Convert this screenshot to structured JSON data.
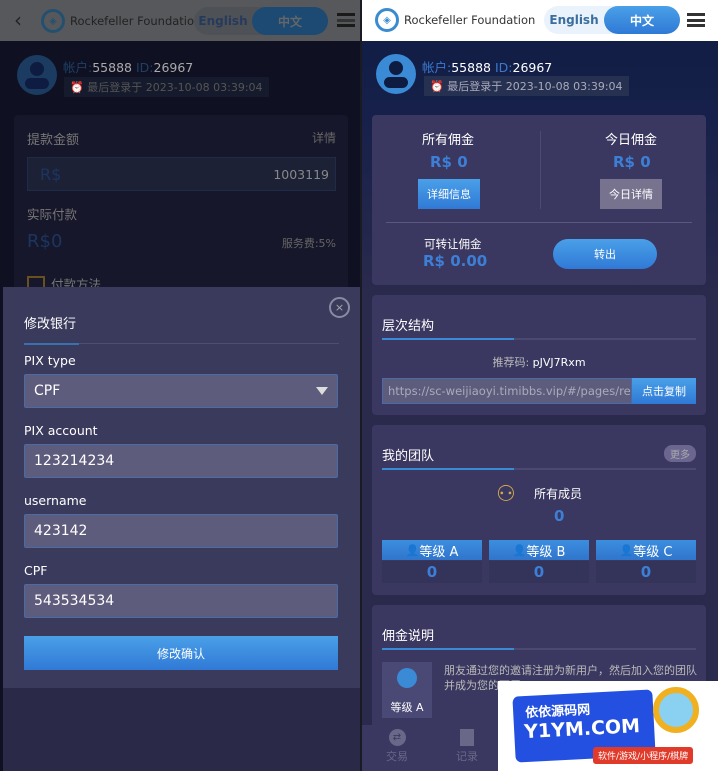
{
  "header": {
    "brand": "Rockefeller Foundation",
    "lang_en": "English",
    "lang_zh": "中文"
  },
  "user": {
    "account_label": "帐户:",
    "account": "55888",
    "id_label": "ID:",
    "id": "26967",
    "last_login": "最后登录于 2023-10-08 03:39:04"
  },
  "withdraw": {
    "title": "提款金额",
    "detail": "详情",
    "currency": "R$",
    "balance": "1003119",
    "actual_label": "实际付款",
    "actual_value": "R$0",
    "fee": "服务费:5%",
    "method": "付款方法"
  },
  "modal": {
    "title": "修改银行",
    "fields": [
      {
        "label": "PIX type",
        "value": "CPF"
      },
      {
        "label": "PIX account",
        "value": "123214234"
      },
      {
        "label": "username",
        "value": "423142"
      },
      {
        "label": "CPF",
        "value": "543534534"
      }
    ],
    "submit": "修改确认"
  },
  "commission": {
    "all_label": "所有佣金",
    "all_value": "R$ 0",
    "all_btn": "详细信息",
    "today_label": "今日佣金",
    "today_value": "R$ 0",
    "today_btn": "今日详情",
    "transfer_label": "可转让佣金",
    "transfer_value": "R$ 0.00",
    "transfer_btn": "转出"
  },
  "hierarchy": {
    "title": "层次结构",
    "ref_label": "推荐码:",
    "ref_code": "pJVJ7Rxm",
    "link": "https://sc-weijiaoyi.timibbs.vip/#/pages/re",
    "copy_btn": "点击复制"
  },
  "team": {
    "title": "我的团队",
    "more": "更多",
    "all_label": "所有成员",
    "all_value": "0",
    "levels": [
      {
        "label": "等级 A",
        "value": "0"
      },
      {
        "label": "等级 B",
        "value": "0"
      },
      {
        "label": "等级 C",
        "value": "0"
      }
    ]
  },
  "explain": {
    "title": "佣金说明",
    "level": "等级 A",
    "text": "朋友通过您的邀请注册为新用户，然后加入您的团队并成为您的下属"
  },
  "nav": [
    {
      "label": "交易",
      "icon": "exchange-icon"
    },
    {
      "label": "记录",
      "icon": "record-icon"
    }
  ],
  "watermark": {
    "line1": "依依源码网",
    "line2": "Y1YM.COM",
    "line3": "软件/游戏/小程序/棋牌"
  },
  "colors": {
    "accent": "#3a8ad6",
    "card": "#3a3860",
    "modal": "#3a3a5c"
  }
}
